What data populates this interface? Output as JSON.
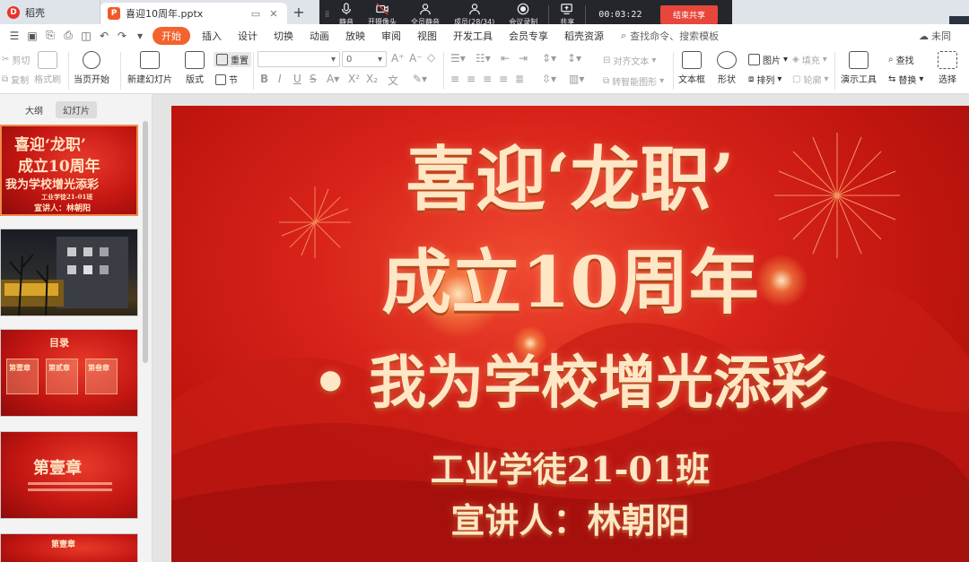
{
  "tabs": [
    {
      "title": "稻壳",
      "icon": "D"
    },
    {
      "title": "喜迎10周年.pptx",
      "icon": "P"
    }
  ],
  "meeting": {
    "buttons": [
      "静音",
      "开摄像头",
      "全员静音",
      "成员(28/34)",
      "会议录制",
      "共享"
    ],
    "timer": "00:03:22",
    "end_share": "结束共享"
  },
  "menu": {
    "items": [
      "开始",
      "插入",
      "设计",
      "切换",
      "动画",
      "放映",
      "审阅",
      "视图",
      "开发工具",
      "会员专享",
      "稻壳资源"
    ],
    "search": "查找命令、搜索模板",
    "sync": "未同"
  },
  "ribbon": {
    "cut": "剪切",
    "copy": "复制",
    "format_painter": "格式刷",
    "from_first": "当页开始",
    "new_slide": "新建幻灯片",
    "layout": "版式",
    "reset": "重置",
    "section": "节",
    "font_size": "0",
    "align_text": "对齐文本",
    "smartart": "转智能图形",
    "textbox": "文本框",
    "shape": "形状",
    "picture": "图片",
    "fill": "填充",
    "arrange": "排列",
    "outline": "轮廓",
    "presenter": "演示工具",
    "find": "查找",
    "replace": "替换",
    "select": "选择"
  },
  "panel": {
    "tabs": [
      "大纲",
      "幻灯片"
    ],
    "thumb3_title": "目录",
    "thumb3_items": [
      "第壹章",
      "第贰章",
      "第叁章"
    ],
    "thumb4_title": "第壹章",
    "thumb5_title": "第壹章"
  },
  "slide": {
    "line1": "喜迎‘龙职’",
    "line2": "成立10周年",
    "line3": "• 我为学校增光添彩",
    "line4": "工业学徒21-01班",
    "line5": "宣讲人：林朝阳"
  },
  "thumb1": {
    "line1": "喜迎‘龙职’",
    "line2": "成立10周年",
    "line3": "我为学校增光添彩",
    "line4": "工业学徒21-01班",
    "line5": "宣讲人：林朝阳"
  },
  "colors": {
    "accent": "#f4622d",
    "meeting_bar": "#25262b",
    "end_share": "#e8463b",
    "slide_red": "#d8231a",
    "slide_text": "#ffe6c4"
  }
}
